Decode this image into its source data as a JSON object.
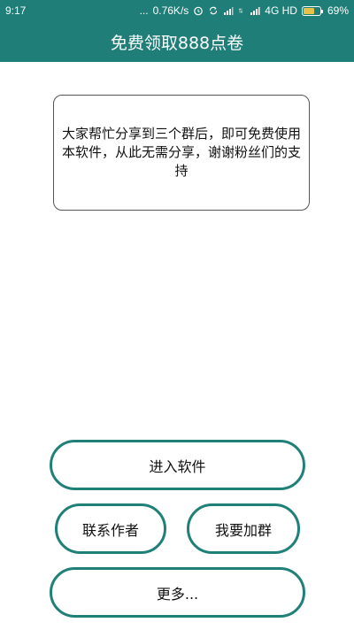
{
  "status_bar": {
    "time": "9:17",
    "dots": "...",
    "speed": "0.76K/s",
    "network": "4G HD",
    "battery": "69%",
    "battery_level": 0.69,
    "icons": [
      "alarm-icon",
      "sync-icon",
      "signal-icon",
      "data-arrows-icon",
      "signal-icon"
    ]
  },
  "app_bar": {
    "title": "免费领取888点卷"
  },
  "notice": {
    "text": "大家帮忙分享到三个群后，即可免费使用本软件，从此无需分享，谢谢粉丝们的支持"
  },
  "buttons": {
    "enter": "进入软件",
    "contact": "联系作者",
    "join_group": "我要加群",
    "more": "更多..."
  },
  "colors": {
    "accent": "#1f7f78",
    "button_border": "#1f8078",
    "background": "#ffffff"
  }
}
